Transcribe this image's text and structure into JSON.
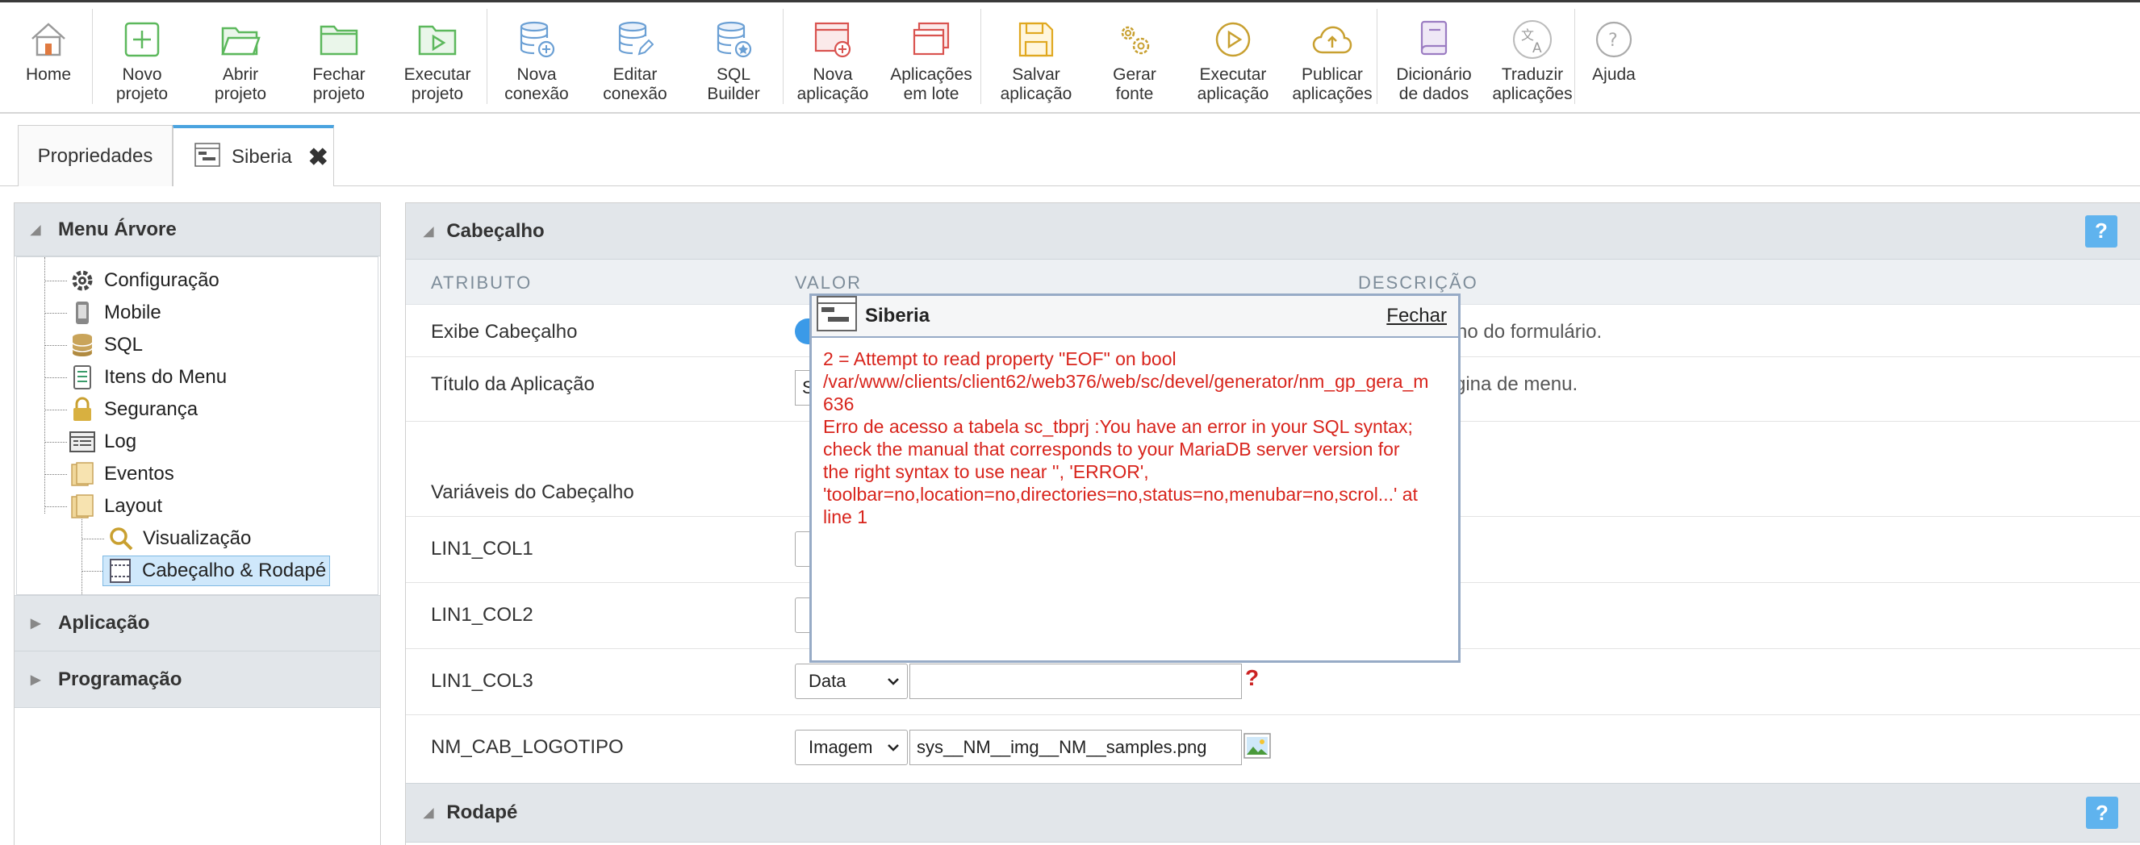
{
  "toolbar": {
    "items": [
      {
        "label": "Home",
        "icon": "home-icon"
      },
      {
        "label": "Novo\nprojeto",
        "icon": "new-project-icon"
      },
      {
        "label": "Abrir\nprojeto",
        "icon": "open-folder-icon"
      },
      {
        "label": "Fechar\nprojeto",
        "icon": "close-folder-icon"
      },
      {
        "label": "Executar\nprojeto",
        "icon": "run-project-icon"
      },
      {
        "label": "Nova\nconexão",
        "icon": "new-connection-icon"
      },
      {
        "label": "Editar\nconexão",
        "icon": "edit-connection-icon"
      },
      {
        "label": "SQL\nBuilder",
        "icon": "sql-builder-icon"
      },
      {
        "label": "Nova\naplicação",
        "icon": "new-application-icon"
      },
      {
        "label": "Aplicações\nem lote",
        "icon": "batch-applications-icon"
      },
      {
        "label": "Salvar\naplicação",
        "icon": "save-icon"
      },
      {
        "label": "Gerar\nfonte",
        "icon": "gears-icon"
      },
      {
        "label": "Executar\naplicação",
        "icon": "play-icon"
      },
      {
        "label": "Publicar\naplicações",
        "icon": "cloud-upload-icon"
      },
      {
        "label": "Dicionário\nde dados",
        "icon": "dictionary-icon"
      },
      {
        "label": "Traduzir\naplicações",
        "icon": "translate-icon"
      },
      {
        "label": "Ajuda",
        "icon": "help-icon"
      }
    ],
    "accent_green": "#5cb85c",
    "accent_blue": "#6a9fd4",
    "accent_red": "#d9534f"
  },
  "tabs": {
    "properties": "Propriedades",
    "siberia": "Siberia",
    "close_glyph": "✖"
  },
  "sidebar": {
    "menu_tree_title": "Menu Árvore",
    "tree": [
      {
        "label": "Configuração",
        "icon": "gear-icon"
      },
      {
        "label": "Mobile",
        "icon": "mobile-icon"
      },
      {
        "label": "SQL",
        "icon": "database-icon"
      },
      {
        "label": "Itens do Menu",
        "icon": "menu-items-icon"
      },
      {
        "label": "Segurança",
        "icon": "lock-icon"
      },
      {
        "label": "Log",
        "icon": "log-icon"
      },
      {
        "label": "Eventos",
        "icon": "events-folder-icon"
      },
      {
        "label": "Layout",
        "icon": "layout-folder-icon"
      },
      {
        "label": "Visualização",
        "icon": "magnifier-icon"
      },
      {
        "label": "Cabeçalho & Rodapé",
        "icon": "header-footer-icon"
      }
    ],
    "application_title": "Aplicação",
    "programming_title": "Programação"
  },
  "main": {
    "header_section": "Cabeçalho",
    "footer_section": "Rodapé",
    "col_attribute": "ATRIBUTO",
    "col_value": "VALOR",
    "col_description": "DESCRIÇÃO",
    "help_glyph": "?",
    "rows": {
      "show_header": {
        "label": "Exibe Cabeçalho",
        "desc": "eçalho do formulário."
      },
      "app_title": {
        "label": "Título da Aplicação",
        "value_start": "S",
        "desc": "gina de menu."
      },
      "header_vars": {
        "label": "Variáveis do Cabeçalho"
      },
      "lin1_col1": {
        "label": "LIN1_COL1"
      },
      "lin1_col2": {
        "label": "LIN1_COL2"
      },
      "lin1_col3": {
        "label": "LIN1_COL3",
        "type": "Data",
        "value": "",
        "help": "?"
      },
      "logo": {
        "label": "NM_CAB_LOGOTIPO",
        "type": "Imagem",
        "value": "sys__NM__img__NM__samples.png"
      }
    }
  },
  "popup": {
    "title": "Siberia",
    "close_label": "Fechar",
    "message": "2 = Attempt to read property \"EOF\" on bool\n/var/www/clients/client62/web376/web/sc/devel/generator/nm_gp_gera_m\n636\nErro de acesso a tabela sc_tbprj :You have an error in your SQL syntax;\ncheck the manual that corresponds to your MariaDB server version for\nthe right syntax to use near '', 'ERROR',\n'toolbar=no,location=no,directories=no,status=no,menubar=no,scrol...' at\nline 1"
  }
}
